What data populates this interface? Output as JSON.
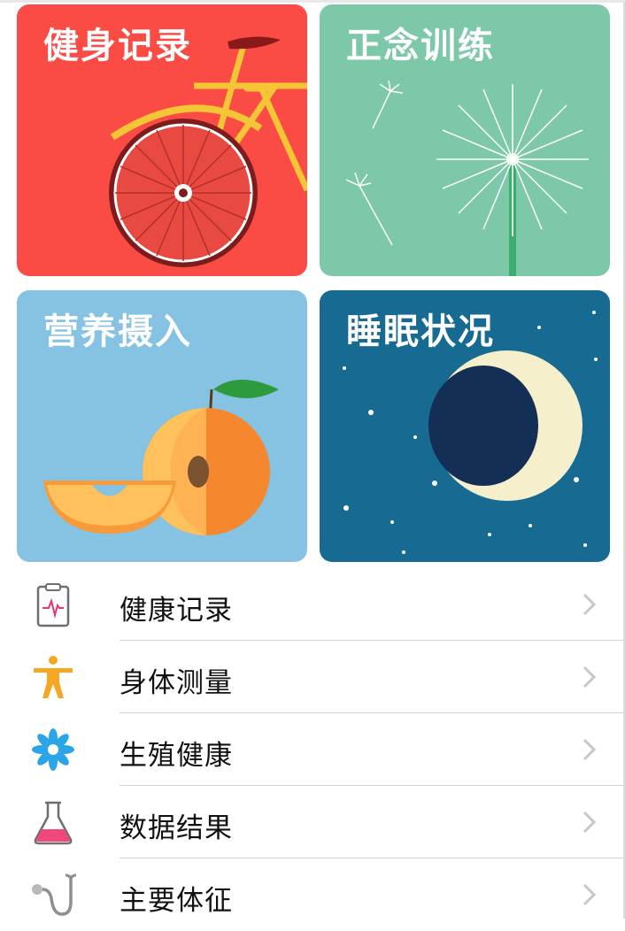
{
  "cards": [
    {
      "title": "健身记录",
      "icon": "bicycle-illustration",
      "color": "#fb4b45"
    },
    {
      "title": "正念训练",
      "icon": "dandelion-illustration",
      "color": "#7dc8a8"
    },
    {
      "title": "营养摄入",
      "icon": "peach-illustration",
      "color": "#86c3e3"
    },
    {
      "title": "睡眠状况",
      "icon": "moon-illustration",
      "color": "#176b92"
    }
  ],
  "list": [
    {
      "label": "健康记录",
      "icon": "clipboard-heartbeat-icon",
      "color": "#e8356b"
    },
    {
      "label": "身体测量",
      "icon": "body-figure-icon",
      "color": "#f5a623"
    },
    {
      "label": "生殖健康",
      "icon": "flower-icon",
      "color": "#2aa6e8"
    },
    {
      "label": "数据结果",
      "icon": "flask-icon",
      "color": "#f0487a"
    },
    {
      "label": "主要体征",
      "icon": "stethoscope-icon",
      "color": "#8e8e93"
    }
  ],
  "chevron": "chevron-right-icon"
}
